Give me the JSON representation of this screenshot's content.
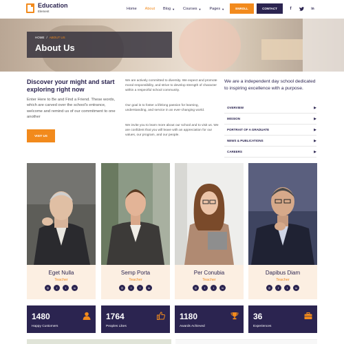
{
  "header": {
    "logo_title": "Education",
    "logo_sub": "Element",
    "nav": [
      {
        "label": "Home",
        "caret": false,
        "active": false
      },
      {
        "label": "About",
        "caret": false,
        "active": true
      },
      {
        "label": "Blog",
        "caret": true,
        "active": false
      },
      {
        "label": "Courses",
        "caret": true,
        "active": false
      },
      {
        "label": "Pages",
        "caret": true,
        "active": false
      }
    ],
    "enroll_label": "ENROLL",
    "contact_label": "CONTACT",
    "social": [
      "f",
      "t",
      "in"
    ]
  },
  "hero": {
    "breadcrumb_home": "HOME",
    "breadcrumb_sep": "/",
    "breadcrumb_current": "ABOUT US",
    "title": "About Us"
  },
  "intro": {
    "heading": "Discover your might and start exploring right now",
    "paragraph": "Enter Here to Be and Find a Friend. These words, which are carved over the school's entrance, welcome and remind us of our commitment to one another",
    "button_label": "VISIT US"
  },
  "middle": {
    "p1": "We are actively committed to diversity. We expect and promote moral responsibility, and strive to develop strength of character within a respectful school community.",
    "p2": "Our goal is to foster a lifelong passion for learning, understanding, and service in an ever-changing world.",
    "p3": "We invite you to learn more about our school and to visit us. We are confident that you will leave with an appreciation for our values, our program, and our people."
  },
  "right": {
    "heading": "We are a independent day school dedicated to inspiring excellence with a purpose.",
    "accordion": [
      "OVERVIEW",
      "MISSION",
      "PORTRAIT OF A GRADUATE",
      "NEWS & PUBLICATIONS",
      "CAREERS"
    ]
  },
  "team": [
    {
      "name": "Eget Nulla",
      "role": "Teacher"
    },
    {
      "name": "Semp Porta",
      "role": "Teacher"
    },
    {
      "name": "Per Conubia",
      "role": "Teacher"
    },
    {
      "name": "Dapibus Diam",
      "role": "Teacher"
    }
  ],
  "team_social": [
    "◎",
    "f",
    "t",
    "in"
  ],
  "stats": [
    {
      "number": "1480",
      "label": "Happy Customers",
      "icon": "user-icon"
    },
    {
      "number": "1764",
      "label": "Peoples Likes",
      "icon": "thumbs-up-icon"
    },
    {
      "number": "1180",
      "label": "Awards Achieved",
      "icon": "trophy-icon"
    },
    {
      "number": "36",
      "label": "Experiences",
      "icon": "briefcase-icon"
    }
  ],
  "colors": {
    "accent": "#f28a1c",
    "navy": "#2b2450",
    "card_bg": "#fcefe2"
  }
}
